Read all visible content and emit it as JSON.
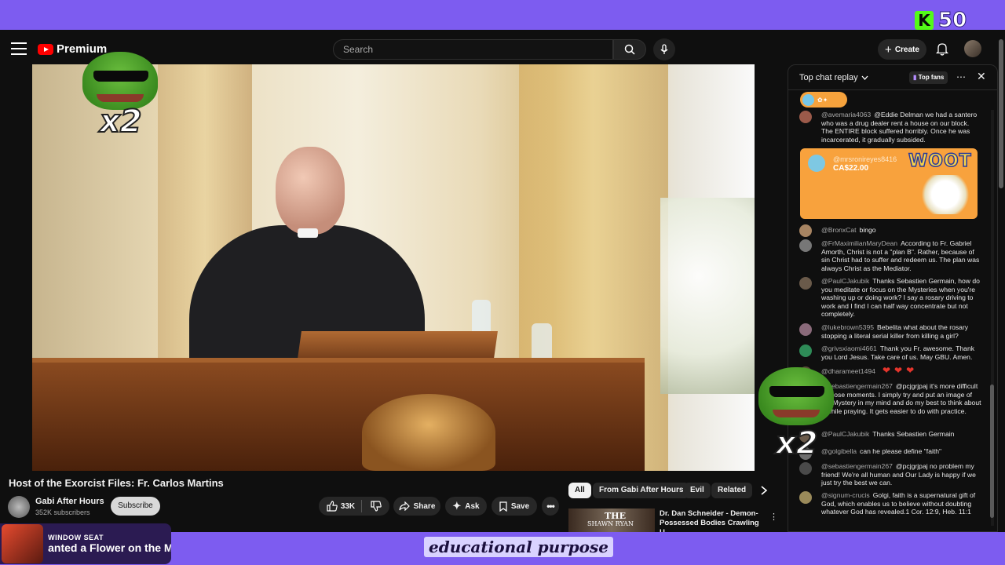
{
  "header": {
    "brand": "Premium",
    "search_placeholder": "Search",
    "create_label": "Create"
  },
  "overlay": {
    "kick_count": "50",
    "emote_multiplier": "x2",
    "caption": "educational purpose",
    "window_seat_label": "WINDOW SEAT",
    "window_seat_title": "anted a Flower on the M"
  },
  "video": {
    "title": "Host of the Exorcist Files: Fr. Carlos Martins",
    "channel": "Gabi After Hours",
    "subscribers": "352K subscribers",
    "subscribe_label": "Subscribe",
    "likes": "33K",
    "share_label": "Share",
    "ask_label": "Ask",
    "save_label": "Save"
  },
  "filters": [
    "All",
    "From Gabi After Hours",
    "Evil",
    "Related"
  ],
  "recommended": {
    "thumb_text": "THE",
    "thumb_sub": "SHAWN RYAN",
    "title": "Dr. Dan Schneider - Demon-Possessed Bodies Crawling U..."
  },
  "chat": {
    "title": "Top chat replay",
    "top_fans": "Top fans",
    "superchat": {
      "author": "@mrsronireyes8416",
      "amount": "CA$22.00",
      "sticker_text": "WOOT"
    },
    "messages": [
      {
        "author": "@avemaria4063",
        "text": "@Eddie Delman we had a santero who was a drug dealer rent a house on our block. The ENTIRE block suffered horribly. Once he was incarcerated, it gradually subsided."
      },
      {
        "author": "@BronxCat",
        "text": "bingo"
      },
      {
        "author": "@FrMaximilianMaryDean",
        "text": "According to Fr. Gabriel Amorth, Christ is not a \"plan B\". Rather, because of sin Christ had to suffer and redeem us. The plan was always Christ as the Mediator."
      },
      {
        "author": "@PaulCJakubik",
        "text": "Thanks Sebastien Germain, how do you meditate or focus on the Mysteries when you're washing up or doing work? I say a rosary driving to work and I find I can half way concentrate but not completely."
      },
      {
        "author": "@lukebrown5395",
        "text": "Bebelita what about the rosary stopping a literal serial killer from killing a girl?"
      },
      {
        "author": "@grivsxiaomi4661",
        "text": "Thank you Fr. awesome. Thank you Lord Jesus. Take care of us. May GBU. Amen."
      },
      {
        "author": "@dharameet1494",
        "text": ""
      },
      {
        "author": "@sebastiengermain267",
        "text": "@pcjgrjpaj it's more difficult in those moments. I simply try and put an image of the Mystery in my mind and do my best to think about it while praying. It gets easier to do with practice."
      },
      {
        "author": "@PaulCJakubik",
        "text": "Thanks Sebastien Germain"
      },
      {
        "author": "@golgibella",
        "text": "can he please define \"faith\""
      },
      {
        "author": "@sebastiengermain267",
        "text": "@pcjgrjpaj no problem my friend! We're all human and Our Lady is happy if we just try the best we can."
      },
      {
        "author": "@signum-crucis",
        "text": "Golgi, faith is a supernatural gift of God, which enables us to believe without doubting whatever God has revealed.1 Cor. 12:9, Heb. 11:1"
      }
    ]
  },
  "colors": {
    "overlay_purple": "#7d5cf0",
    "youtube_red": "#ff0000",
    "superchat_orange": "#f8a23d",
    "kick_green": "#53fc18"
  }
}
